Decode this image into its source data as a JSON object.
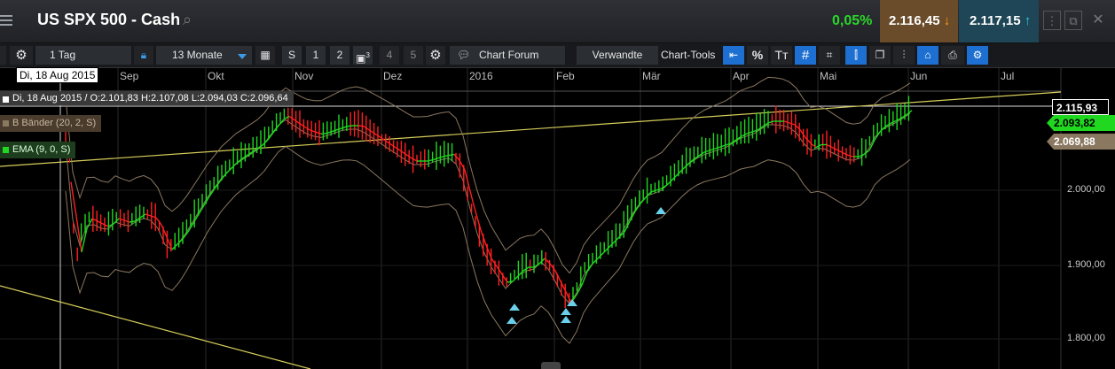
{
  "header": {
    "title": "US SPX 500 - Cash",
    "change": "0,05%",
    "bid": "2.116,45",
    "ask": "2.117,15",
    "bid_arrow": "↓",
    "ask_arrow": "↑"
  },
  "toolbar": {
    "interval": "1 Tag",
    "range": "13 Monate",
    "layout_s": "S",
    "layout_1": "1",
    "layout_2": "2",
    "layout_3_sup": "3",
    "layout_4": "4",
    "layout_5": "5",
    "chart_forum": "Chart Forum",
    "verwandte": "Verwandte",
    "chart_tools": "Chart-Tools",
    "percent": "%",
    "text_tool": "Tт"
  },
  "chart": {
    "months": [
      "Sep",
      "Okt",
      "Nov",
      "Dez",
      "2016",
      "Feb",
      "Mär",
      "Apr",
      "Mai",
      "Jun",
      "Jul"
    ],
    "crosshair_date": "Di, 18 Aug 2015",
    "ohlc": "Di, 18 Aug 2015 / O:2.101,83  H:2.107,08  L:2.094,03  C:2.096,64",
    "bb_label": "B Bänder (20, 2, S)",
    "ema_label": "EMA (9, 0, S)",
    "y_ticks": [
      "2.000,00",
      "1.900,00",
      "1.800,00"
    ],
    "last_price": "2.115,93",
    "ema_value": "2.093,82",
    "bb_value": "2.069,88"
  },
  "colors": {
    "bull": "#1fd81f",
    "bear": "#ff2020",
    "bands": "#8a7860",
    "ema_up": "#1fd81f",
    "ema_down": "#ff2020",
    "trendline": "#d6cd5a",
    "accent_blue": "#1d6fd1",
    "bid_bg": "#6a4c2a",
    "ask_bg": "#1f4656",
    "marker": "#6ad0ea"
  }
}
